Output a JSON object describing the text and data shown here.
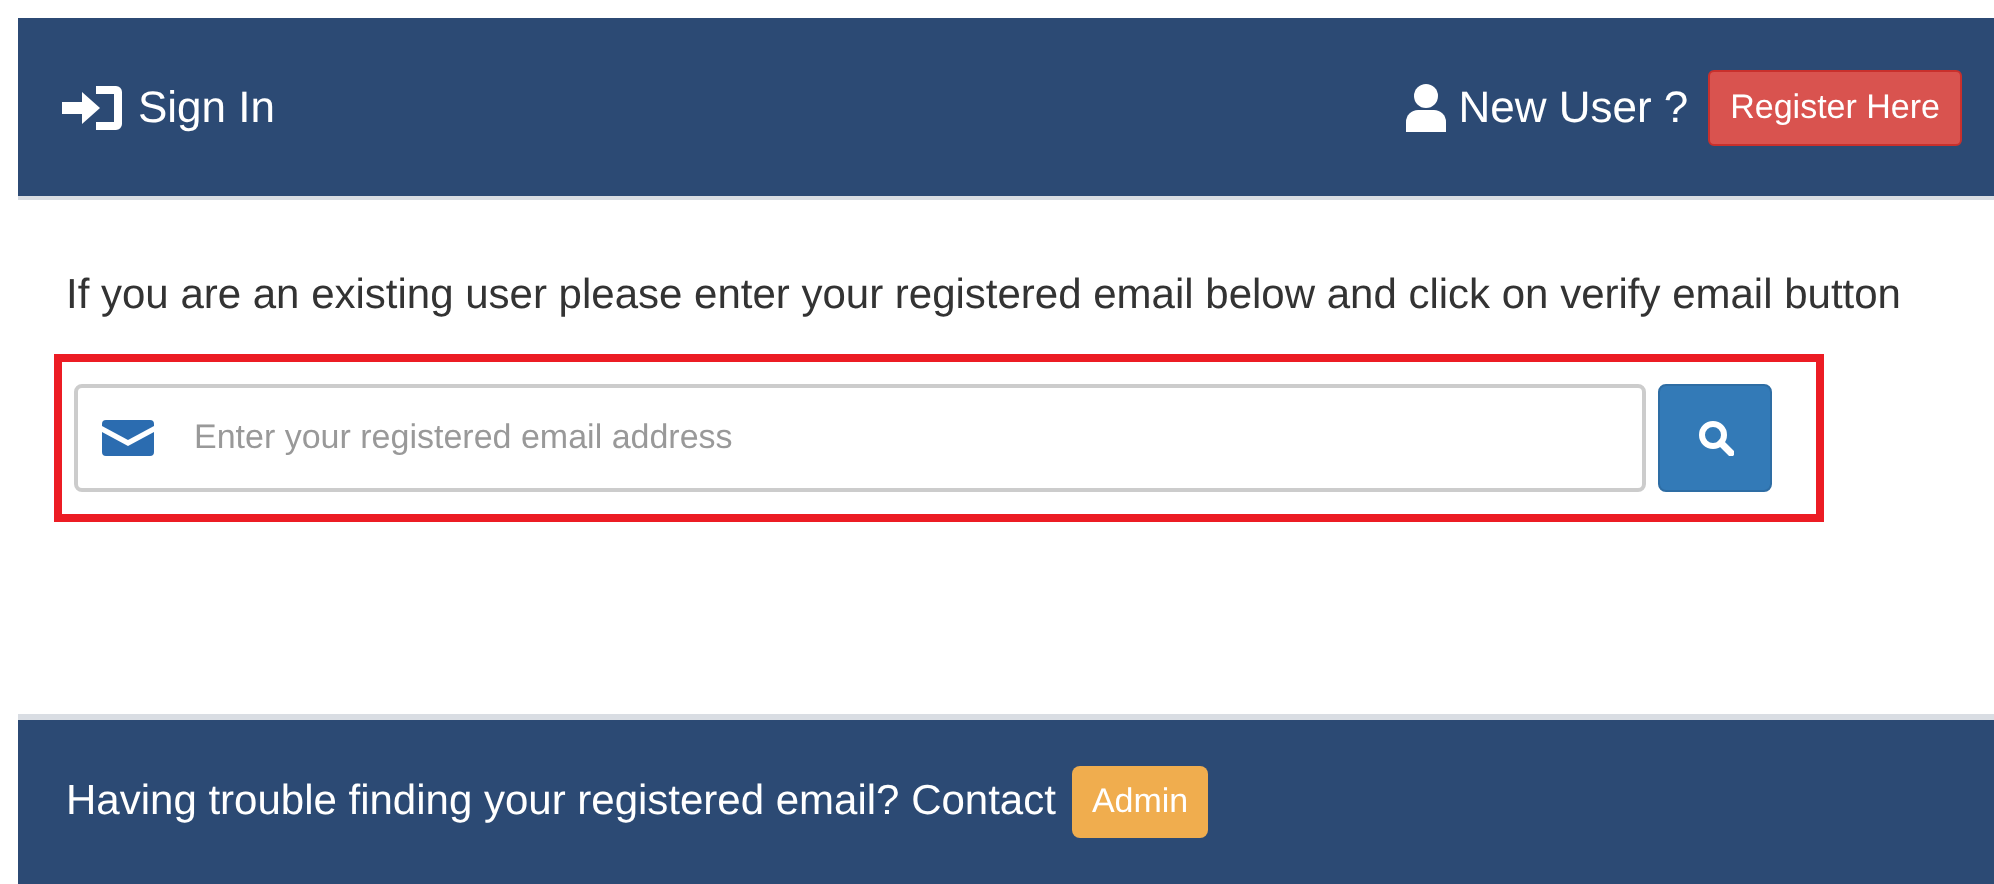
{
  "header": {
    "title": "Sign In",
    "new_user_label": "New User ?",
    "register_button": "Register Here"
  },
  "intro": "If you are an existing user please enter your registered email below and click on verify email button",
  "email_search": {
    "placeholder": "Enter your registered email address",
    "highlighted": true
  },
  "footer": {
    "text": "Having trouble finding your registered email? Contact",
    "admin_button": "Admin"
  }
}
